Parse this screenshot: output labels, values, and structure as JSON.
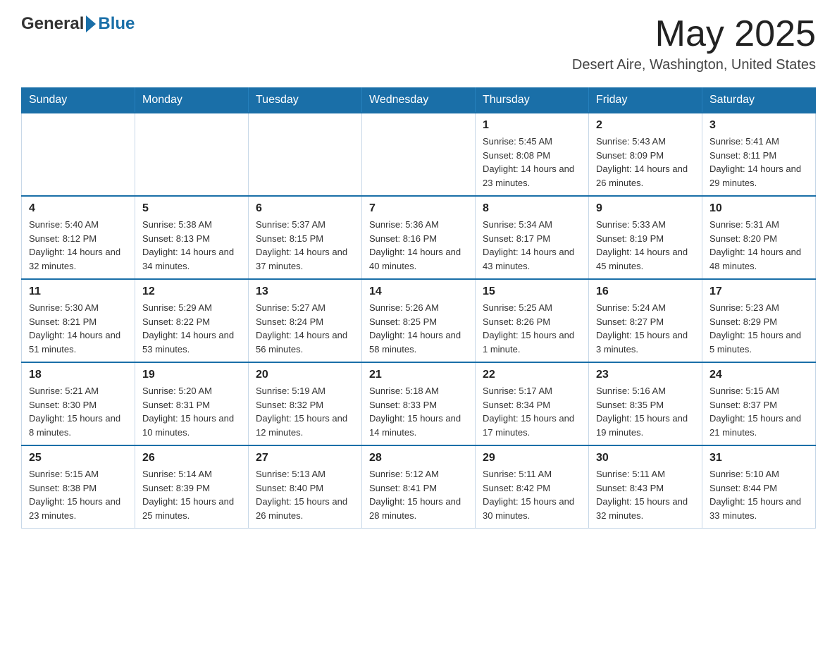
{
  "header": {
    "logo": {
      "general": "General",
      "arrow": "▶",
      "blue": "Blue"
    },
    "title": "May 2025",
    "location": "Desert Aire, Washington, United States"
  },
  "calendar": {
    "days_of_week": [
      "Sunday",
      "Monday",
      "Tuesday",
      "Wednesday",
      "Thursday",
      "Friday",
      "Saturday"
    ],
    "weeks": [
      [
        {
          "day": "",
          "info": ""
        },
        {
          "day": "",
          "info": ""
        },
        {
          "day": "",
          "info": ""
        },
        {
          "day": "",
          "info": ""
        },
        {
          "day": "1",
          "info": "Sunrise: 5:45 AM\nSunset: 8:08 PM\nDaylight: 14 hours and 23 minutes."
        },
        {
          "day": "2",
          "info": "Sunrise: 5:43 AM\nSunset: 8:09 PM\nDaylight: 14 hours and 26 minutes."
        },
        {
          "day": "3",
          "info": "Sunrise: 5:41 AM\nSunset: 8:11 PM\nDaylight: 14 hours and 29 minutes."
        }
      ],
      [
        {
          "day": "4",
          "info": "Sunrise: 5:40 AM\nSunset: 8:12 PM\nDaylight: 14 hours and 32 minutes."
        },
        {
          "day": "5",
          "info": "Sunrise: 5:38 AM\nSunset: 8:13 PM\nDaylight: 14 hours and 34 minutes."
        },
        {
          "day": "6",
          "info": "Sunrise: 5:37 AM\nSunset: 8:15 PM\nDaylight: 14 hours and 37 minutes."
        },
        {
          "day": "7",
          "info": "Sunrise: 5:36 AM\nSunset: 8:16 PM\nDaylight: 14 hours and 40 minutes."
        },
        {
          "day": "8",
          "info": "Sunrise: 5:34 AM\nSunset: 8:17 PM\nDaylight: 14 hours and 43 minutes."
        },
        {
          "day": "9",
          "info": "Sunrise: 5:33 AM\nSunset: 8:19 PM\nDaylight: 14 hours and 45 minutes."
        },
        {
          "day": "10",
          "info": "Sunrise: 5:31 AM\nSunset: 8:20 PM\nDaylight: 14 hours and 48 minutes."
        }
      ],
      [
        {
          "day": "11",
          "info": "Sunrise: 5:30 AM\nSunset: 8:21 PM\nDaylight: 14 hours and 51 minutes."
        },
        {
          "day": "12",
          "info": "Sunrise: 5:29 AM\nSunset: 8:22 PM\nDaylight: 14 hours and 53 minutes."
        },
        {
          "day": "13",
          "info": "Sunrise: 5:27 AM\nSunset: 8:24 PM\nDaylight: 14 hours and 56 minutes."
        },
        {
          "day": "14",
          "info": "Sunrise: 5:26 AM\nSunset: 8:25 PM\nDaylight: 14 hours and 58 minutes."
        },
        {
          "day": "15",
          "info": "Sunrise: 5:25 AM\nSunset: 8:26 PM\nDaylight: 15 hours and 1 minute."
        },
        {
          "day": "16",
          "info": "Sunrise: 5:24 AM\nSunset: 8:27 PM\nDaylight: 15 hours and 3 minutes."
        },
        {
          "day": "17",
          "info": "Sunrise: 5:23 AM\nSunset: 8:29 PM\nDaylight: 15 hours and 5 minutes."
        }
      ],
      [
        {
          "day": "18",
          "info": "Sunrise: 5:21 AM\nSunset: 8:30 PM\nDaylight: 15 hours and 8 minutes."
        },
        {
          "day": "19",
          "info": "Sunrise: 5:20 AM\nSunset: 8:31 PM\nDaylight: 15 hours and 10 minutes."
        },
        {
          "day": "20",
          "info": "Sunrise: 5:19 AM\nSunset: 8:32 PM\nDaylight: 15 hours and 12 minutes."
        },
        {
          "day": "21",
          "info": "Sunrise: 5:18 AM\nSunset: 8:33 PM\nDaylight: 15 hours and 14 minutes."
        },
        {
          "day": "22",
          "info": "Sunrise: 5:17 AM\nSunset: 8:34 PM\nDaylight: 15 hours and 17 minutes."
        },
        {
          "day": "23",
          "info": "Sunrise: 5:16 AM\nSunset: 8:35 PM\nDaylight: 15 hours and 19 minutes."
        },
        {
          "day": "24",
          "info": "Sunrise: 5:15 AM\nSunset: 8:37 PM\nDaylight: 15 hours and 21 minutes."
        }
      ],
      [
        {
          "day": "25",
          "info": "Sunrise: 5:15 AM\nSunset: 8:38 PM\nDaylight: 15 hours and 23 minutes."
        },
        {
          "day": "26",
          "info": "Sunrise: 5:14 AM\nSunset: 8:39 PM\nDaylight: 15 hours and 25 minutes."
        },
        {
          "day": "27",
          "info": "Sunrise: 5:13 AM\nSunset: 8:40 PM\nDaylight: 15 hours and 26 minutes."
        },
        {
          "day": "28",
          "info": "Sunrise: 5:12 AM\nSunset: 8:41 PM\nDaylight: 15 hours and 28 minutes."
        },
        {
          "day": "29",
          "info": "Sunrise: 5:11 AM\nSunset: 8:42 PM\nDaylight: 15 hours and 30 minutes."
        },
        {
          "day": "30",
          "info": "Sunrise: 5:11 AM\nSunset: 8:43 PM\nDaylight: 15 hours and 32 minutes."
        },
        {
          "day": "31",
          "info": "Sunrise: 5:10 AM\nSunset: 8:44 PM\nDaylight: 15 hours and 33 minutes."
        }
      ]
    ]
  }
}
